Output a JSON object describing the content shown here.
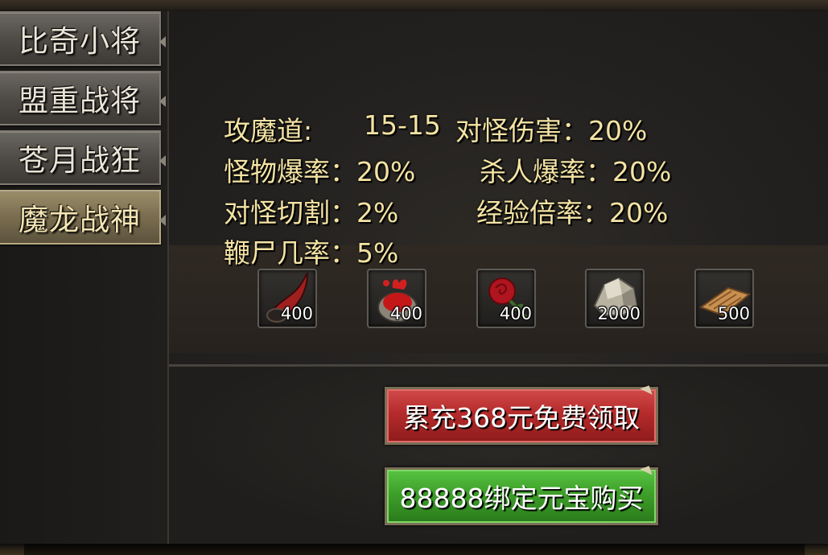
{
  "sidebar": {
    "tabs": [
      {
        "label": "比奇小将",
        "active": false
      },
      {
        "label": "盟重战将",
        "active": false
      },
      {
        "label": "苍月战狂",
        "active": false
      },
      {
        "label": "魔龙战神",
        "active": true
      }
    ]
  },
  "stats": {
    "attack_label": "攻魔道:",
    "attack_value": "15-15",
    "monster_damage": "对怪伤害：20%",
    "monster_drop": "怪物爆率：20%",
    "kill_drop": "杀人爆率：20%",
    "monster_cut": "对怪切割：2%",
    "exp_rate": "经验倍率：20%",
    "whip_rate": "鞭尸几率：5%"
  },
  "rewards": [
    {
      "icon": "horn-icon",
      "count": "400"
    },
    {
      "icon": "blood-potion-icon",
      "count": "400"
    },
    {
      "icon": "red-rose-icon",
      "count": "400"
    },
    {
      "icon": "ore-stone-icon",
      "count": "2000"
    },
    {
      "icon": "scroll-icon",
      "count": "500"
    }
  ],
  "buttons": {
    "claim_label": "累充368元免费领取",
    "buy_label": "88888绑定元宝购买"
  },
  "colors": {
    "stat_text": "#f4e3a3",
    "claim_button": "#b52b2b",
    "buy_button": "#3e9f2a",
    "active_tab": "#7a6d4f"
  }
}
